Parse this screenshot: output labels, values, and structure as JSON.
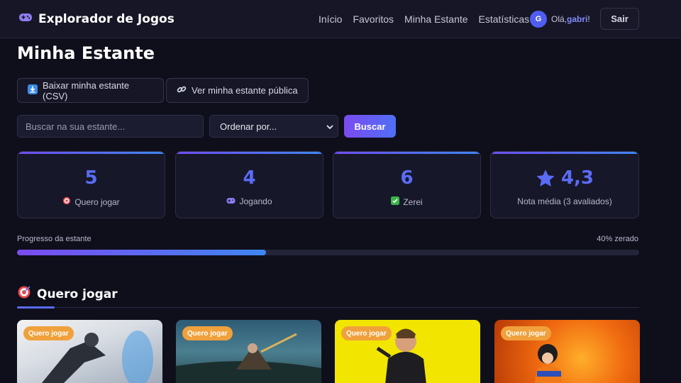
{
  "app": {
    "title": "Explorador de Jogos",
    "logo_icon": "gamepad-icon"
  },
  "nav": {
    "items": [
      "Início",
      "Favoritos",
      "Minha Estante",
      "Estatísticas"
    ]
  },
  "user": {
    "avatar_letter": "G",
    "greeting": "Olá,",
    "name": "gabri",
    "suffix": "!",
    "logout_label": "Sair"
  },
  "page": {
    "title": "Minha Estante"
  },
  "actions": {
    "download_label": "Baixar minha estante (CSV)",
    "download_icon": "download-icon",
    "public_label": "Ver minha estante pública",
    "public_icon": "link-icon"
  },
  "filters": {
    "search_placeholder": "Buscar na sua estante...",
    "sort_value": "Ordenar por...",
    "search_button": "Buscar"
  },
  "stats": [
    {
      "value": "5",
      "label": "Quero jogar",
      "icon": "target-icon"
    },
    {
      "value": "4",
      "label": "Jogando",
      "icon": "gamepad-icon"
    },
    {
      "value": "6",
      "label": "Zerei",
      "icon": "check-icon"
    },
    {
      "value": "4,3",
      "label": "Nota média (3 avaliados)",
      "icon": "star-icon"
    }
  ],
  "progress": {
    "label": "Progresso da estante",
    "value_text": "40% zerado",
    "fraction": 0.4
  },
  "section": {
    "title": "Quero jogar",
    "icon": "target-icon"
  },
  "games": [
    {
      "badge": "Quero jogar"
    },
    {
      "badge": "Quero jogar"
    },
    {
      "badge": "Quero jogar"
    },
    {
      "badge": "Quero jogar"
    }
  ],
  "colors": {
    "accent": "#5a6cf5",
    "gradient_start": "#7b4bf0",
    "gradient_end": "#3f86f0",
    "badge": "#f0a13c"
  }
}
